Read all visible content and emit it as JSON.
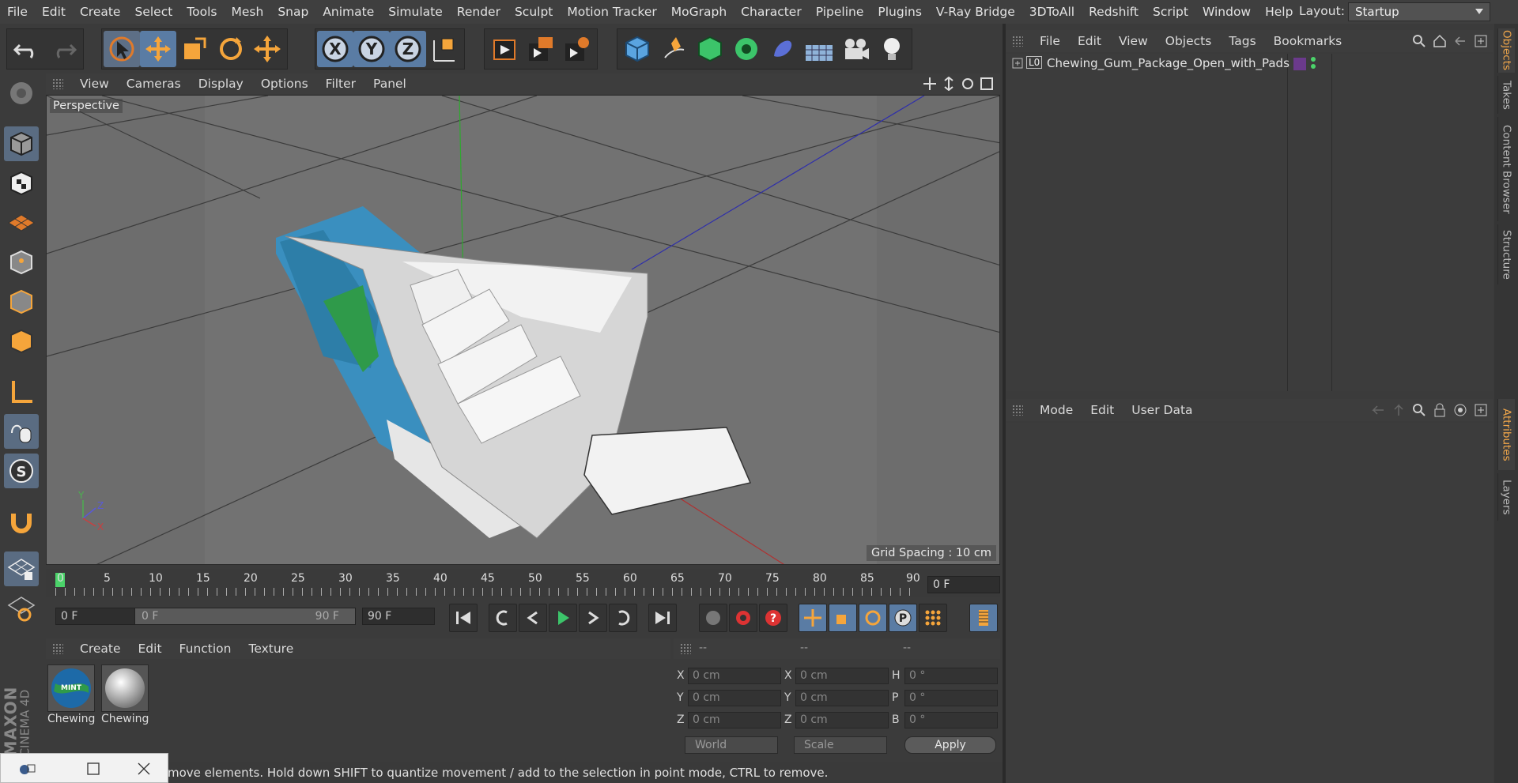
{
  "menubar": {
    "items": [
      "File",
      "Edit",
      "Create",
      "Select",
      "Tools",
      "Mesh",
      "Snap",
      "Animate",
      "Simulate",
      "Render",
      "Sculpt",
      "Motion Tracker",
      "MoGraph",
      "Character",
      "Pipeline",
      "Plugins",
      "V-Ray Bridge",
      "3DToAll",
      "Redshift",
      "Script",
      "Window",
      "Help"
    ],
    "layout_label": "Layout:",
    "layout_value": "Startup"
  },
  "toolbar": {
    "icons": [
      "undo-icon",
      "redo-icon",
      "live-selection-icon",
      "move-icon",
      "scale-icon",
      "rotate-icon",
      "move-axis-icon",
      "x-axis-icon",
      "y-axis-icon",
      "z-axis-icon",
      "coordinate-system-icon",
      "render-view-icon",
      "render-picture-viewer-icon",
      "render-settings-icon",
      "cube-icon",
      "pen-icon",
      "subdivision-icon",
      "cloner-icon",
      "deformer-icon",
      "floor-icon",
      "camera-icon",
      "light-icon"
    ]
  },
  "viewport": {
    "menus": [
      "View",
      "Cameras",
      "Display",
      "Options",
      "Filter",
      "Panel"
    ],
    "label": "Perspective",
    "grid_spacing": "Grid Spacing : 10 cm",
    "axis_labels": {
      "y": "Y",
      "z": "Z",
      "x": "X"
    }
  },
  "timeline": {
    "ticks": [
      "0",
      "5",
      "10",
      "15",
      "20",
      "25",
      "30",
      "35",
      "40",
      "45",
      "50",
      "55",
      "60",
      "65",
      "70",
      "75",
      "80",
      "85",
      "90"
    ],
    "current_frame": "0 F",
    "start_field": "0 F",
    "range_start": "0 F",
    "range_end": "90 F",
    "end_field": "90 F"
  },
  "materials": {
    "menus": [
      "Create",
      "Edit",
      "Function",
      "Texture"
    ],
    "items": [
      {
        "name": "Chewing",
        "label": "MINT"
      },
      {
        "name": "Chewing"
      }
    ]
  },
  "coordinates": {
    "headers": [
      "--",
      "--",
      "--"
    ],
    "rows": [
      {
        "l1": "X",
        "v1": "0 cm",
        "l2": "X",
        "v2": "0 cm",
        "l3": "H",
        "v3": "0 °"
      },
      {
        "l1": "Y",
        "v1": "0 cm",
        "l2": "Y",
        "v2": "0 cm",
        "l3": "P",
        "v3": "0 °"
      },
      {
        "l1": "Z",
        "v1": "0 cm",
        "l2": "Z",
        "v2": "0 cm",
        "l3": "B",
        "v3": "0 °"
      }
    ],
    "mode": "World",
    "transform": "Scale",
    "apply": "Apply"
  },
  "objects": {
    "menus": [
      "File",
      "Edit",
      "View",
      "Objects",
      "Tags",
      "Bookmarks"
    ],
    "item": "Chewing_Gum_Package_Open_with_Pads",
    "item_prefix": "L0"
  },
  "attributes": {
    "menus": [
      "Mode",
      "Edit",
      "User Data"
    ]
  },
  "side_tabs": [
    "Objects",
    "Takes",
    "Content Browser",
    "Structure",
    "Attributes",
    "Layers"
  ],
  "status": "move elements. Hold down SHIFT to quantize movement / add to the selection in point mode, CTRL to remove.",
  "branding": {
    "line1": "MAXON",
    "line2": "CINEMA 4D"
  },
  "colors": {
    "accent": "#5a7ca4",
    "orange": "#f0a64a",
    "viewport": "#6d6d6d"
  }
}
